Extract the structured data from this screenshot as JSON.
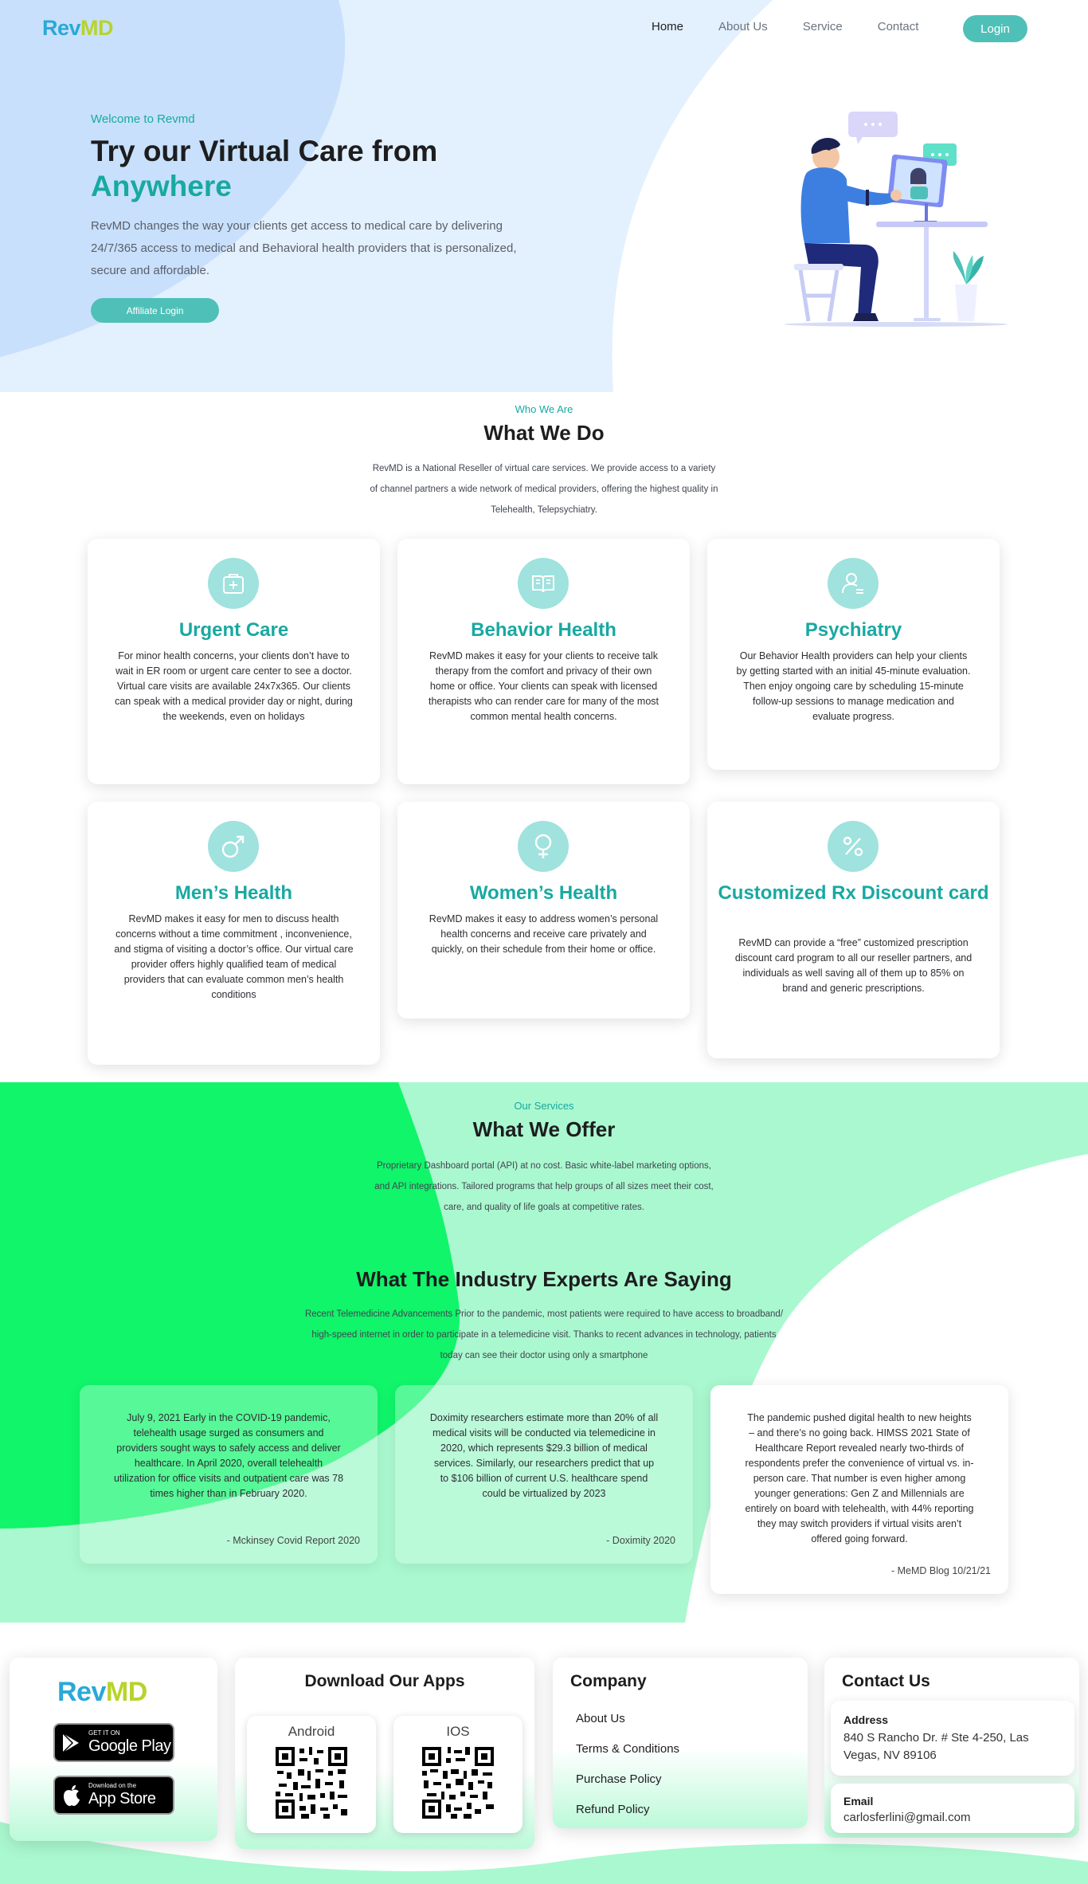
{
  "header": {
    "logo_rev": "Rev",
    "logo_md": "MD",
    "nav": [
      "Home",
      "About Us",
      "Service",
      "Contact"
    ],
    "login": "Login"
  },
  "hero": {
    "eyebrow": "Welcome to Revmd",
    "title_line1": "Try our Virtual Care from",
    "title_line2": "Anywhere",
    "text": "RevMD changes the way your clients get access to medical care by delivering 24/7/365 access to medical and Behavioral health providers that is personalized, secure and affordable.",
    "cta": "Affiliate Login"
  },
  "what_we_do": {
    "eyebrow": "Who We Are",
    "title": "What We Do",
    "text": "RevMD is a National Reseller of virtual care services. We provide access to a variety of channel partners a wide network of medical providers, offering the highest quality in Telehealth, Telepsychiatry.",
    "cards": [
      {
        "icon": "first-aid-kit-icon",
        "title": "Urgent Care",
        "text": "For minor health concerns, your clients don’t have to wait in ER room or urgent care center to see a doctor. Virtual care visits are available 24x7x365. Our clients can speak with a medical provider day or night, during the weekends, even on holidays"
      },
      {
        "icon": "open-book-icon",
        "title": "Behavior Health",
        "text": "RevMD makes it easy for your clients to receive talk therapy from the comfort and privacy of their own home or office. Your clients can speak with licensed therapists who can render care for many of the most common mental health concerns."
      },
      {
        "icon": "user-check-icon",
        "title": "Psychiatry",
        "text": "Our Behavior Health providers can help your clients by getting started with an initial 45-minute evaluation. Then enjoy ongoing care by scheduling 15-minute follow-up sessions to manage medication and evaluate progress."
      },
      {
        "icon": "male-symbol-icon",
        "title": "Men’s Health",
        "text": "RevMD makes it easy for men to discuss health concerns without a time commitment , inconvenience, and stigma of visiting a doctor’s office. Our virtual care provider offers highly qualified team of medical providers that can evaluate common men’s health conditions"
      },
      {
        "icon": "female-symbol-icon",
        "title": "Women’s Health",
        "text": "RevMD makes it easy to address women’s personal health concerns and receive care privately and quickly, on their schedule from their home or office."
      },
      {
        "icon": "percent-icon",
        "title": "Customized Rx Discount card",
        "text": "RevMD can provide a “free” customized prescription discount card program to all our reseller partners, and individuals as well saving all of them up to 85% on brand and generic prescriptions."
      }
    ]
  },
  "services": {
    "eyebrow": "Our Services",
    "title": "What We Offer",
    "text": "Proprietary Dashboard portal (API) at no cost. Basic white-label marketing options, and API integrations. Tailored programs that help groups of all sizes meet their cost, care, and quality of life goals at competitive rates."
  },
  "experts": {
    "title": "What The Industry Experts Are Saying",
    "text": "Recent Telemedicine Advancements Prior to the pandemic, most patients were required to have access to broadband/ high-speed internet in order to participate in a telemedicine visit. Thanks to recent advances in technology, patients today can see their doctor using only a smartphone",
    "testimonials": [
      {
        "text": "July 9, 2021 Early in the COVID-19 pandemic, telehealth usage surged as consumers and providers sought ways to safely access and deliver healthcare. In April 2020, overall telehealth utilization for office visits and outpatient care was 78 times higher than in February 2020.",
        "source": "- Mckinsey Covid Report 2020"
      },
      {
        "text": "Doximity researchers estimate more than 20% of all medical visits will be conducted via telemedicine in 2020, which represents $29.3 billion of medical services. Similarly, our researchers predict that up to $106 billion of current U.S. healthcare spend could be virtualized by 2023",
        "source": "- Doximity 2020"
      },
      {
        "text": "The pandemic pushed digital health to new heights – and there’s no going back. HIMSS 2021 State of Healthcare Report revealed nearly two-thirds of respondents prefer the convenience of virtual vs. in-person care. That number is even higher among younger generations: Gen Z and Millennials are entirely on board with telehealth, with 44% reporting they may switch providers if virtual visits aren’t offered going forward.",
        "source": "- MeMD Blog 10/21/21"
      }
    ]
  },
  "footer": {
    "logo_rev": "Rev",
    "logo_md": "MD",
    "google_sub": "GET IT ON",
    "google_main": "Google Play",
    "apple_sub": "Download on the",
    "apple_main": "App Store",
    "apps_title": "Download Our Apps",
    "android": "Android",
    "ios": "IOS",
    "company_title": "Company",
    "company_links": [
      "About Us",
      "Terms & Conditions",
      "Purchase Policy",
      "Refund Policy"
    ],
    "contact_title": "Contact Us",
    "address_label": "Address",
    "address": "840 S Rancho Dr. # Ste 4-250, Las Vegas, NV 89106",
    "email_label": "Email",
    "email": "carlosferlini@gmail.com"
  },
  "colors": {
    "teal": "#18a9a1",
    "button": "#4fc0b8",
    "hero_bg": "#e3f0fd",
    "green_bright": "#10f56a",
    "green_light": "#aaf8cf"
  }
}
